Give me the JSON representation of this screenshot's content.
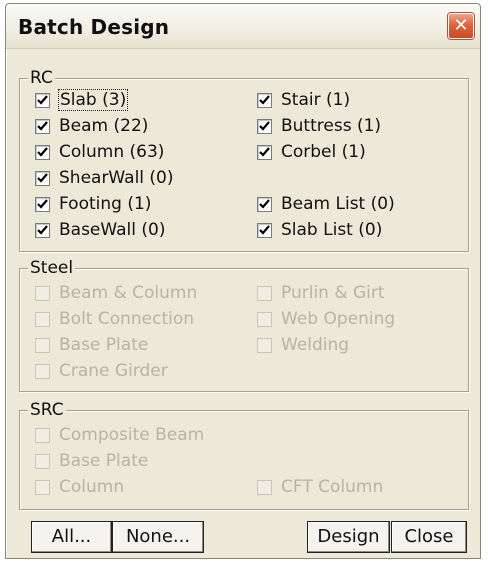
{
  "window": {
    "title": "Batch Design"
  },
  "rc": {
    "legend": "RC",
    "items": [
      {
        "label": "Slab (3)",
        "checked": true
      },
      {
        "label": "Beam (22)",
        "checked": true
      },
      {
        "label": "Column (63)",
        "checked": true
      },
      {
        "label": "ShearWall (0)",
        "checked": true
      },
      {
        "label": "Footing (1)",
        "checked": true
      },
      {
        "label": "BaseWall (0)",
        "checked": true
      },
      {
        "label": "Stair (1)",
        "checked": true
      },
      {
        "label": "Buttress (1)",
        "checked": true
      },
      {
        "label": "Corbel (1)",
        "checked": true
      },
      {
        "label": "Beam List (0)",
        "checked": true
      },
      {
        "label": "Slab List (0)",
        "checked": true
      }
    ]
  },
  "steel": {
    "legend": "Steel",
    "items": [
      {
        "label": "Beam & Column",
        "checked": false,
        "enabled": false
      },
      {
        "label": "Bolt Connection",
        "checked": false,
        "enabled": false
      },
      {
        "label": "Base Plate",
        "checked": false,
        "enabled": false
      },
      {
        "label": "Crane Girder",
        "checked": false,
        "enabled": false
      },
      {
        "label": "Purlin & Girt",
        "checked": false,
        "enabled": false
      },
      {
        "label": "Web Opening",
        "checked": false,
        "enabled": false
      },
      {
        "label": "Welding",
        "checked": false,
        "enabled": false
      }
    ]
  },
  "src": {
    "legend": "SRC",
    "items": [
      {
        "label": "Composite Beam",
        "checked": false,
        "enabled": false
      },
      {
        "label": "Base Plate",
        "checked": false,
        "enabled": false
      },
      {
        "label": "Column",
        "checked": false,
        "enabled": false
      },
      {
        "label": "CFT Column",
        "checked": false,
        "enabled": false
      }
    ]
  },
  "buttons": {
    "all": "All...",
    "none": "None...",
    "design": "Design",
    "close": "Close"
  },
  "icons": {
    "close": "close-icon",
    "check": "checkmark-icon"
  }
}
